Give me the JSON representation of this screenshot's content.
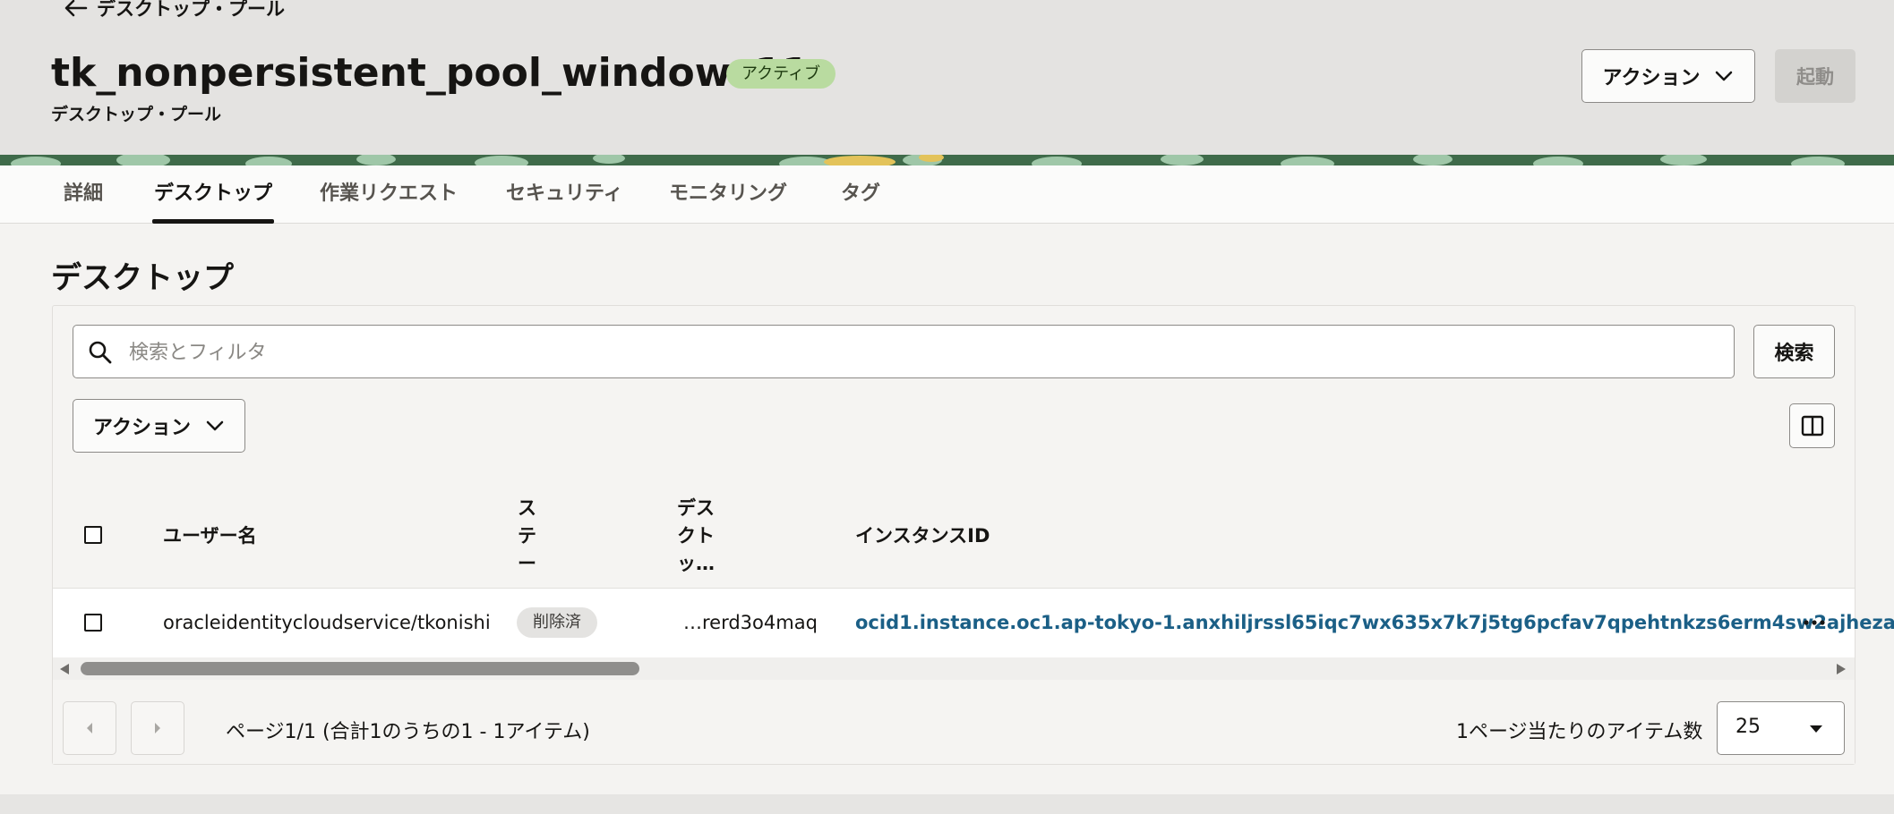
{
  "header": {
    "back_label": "デスクトップ・プール",
    "title": "tk_nonpersistent_pool_windows11",
    "status_badge": "アクティブ",
    "subtitle": "デスクトップ・プール",
    "actions_label": "アクション",
    "launch_label": "起動"
  },
  "tabs": [
    {
      "label": "詳細"
    },
    {
      "label": "デスクトップ",
      "active": true
    },
    {
      "label": "作業リクエスト"
    },
    {
      "label": "セキュリティ"
    },
    {
      "label": "モニタリング"
    },
    {
      "label": "タグ"
    }
  ],
  "section": {
    "title": "デスクトップ",
    "search_placeholder": "検索とフィルタ",
    "search_button": "検索",
    "actions_label": "アクション"
  },
  "table": {
    "headers": {
      "username": "ユーザー名",
      "state_l1": "ス",
      "state_l2": "テ",
      "state_l3": "ー",
      "desktop_l1": "デス",
      "desktop_l2": "クト",
      "desktop_l3": "ッ…",
      "instance_id": "インスタンスID"
    },
    "rows": [
      {
        "username": "oracleidentitycloudservice/tkonishi",
        "state": "削除済",
        "desktop": "…rerd3o4maq",
        "instance_id": "ocid1.instance.oc1.ap-tokyo-1.anxhiljrssl65iqc7wx635x7k7j5tg6pcfav7qpehtnkzs6erm4sw2ajheza"
      }
    ]
  },
  "pagination": {
    "summary": "ページ1/1 (合計1のうちの1 - 1アイテム)",
    "per_page_label": "1ページ当たりのアイテム数",
    "per_page_value": "25"
  },
  "colors": {
    "active_badge": "#b9dba0",
    "link": "#1b5f86",
    "header_bg": "#e4e3e1"
  }
}
